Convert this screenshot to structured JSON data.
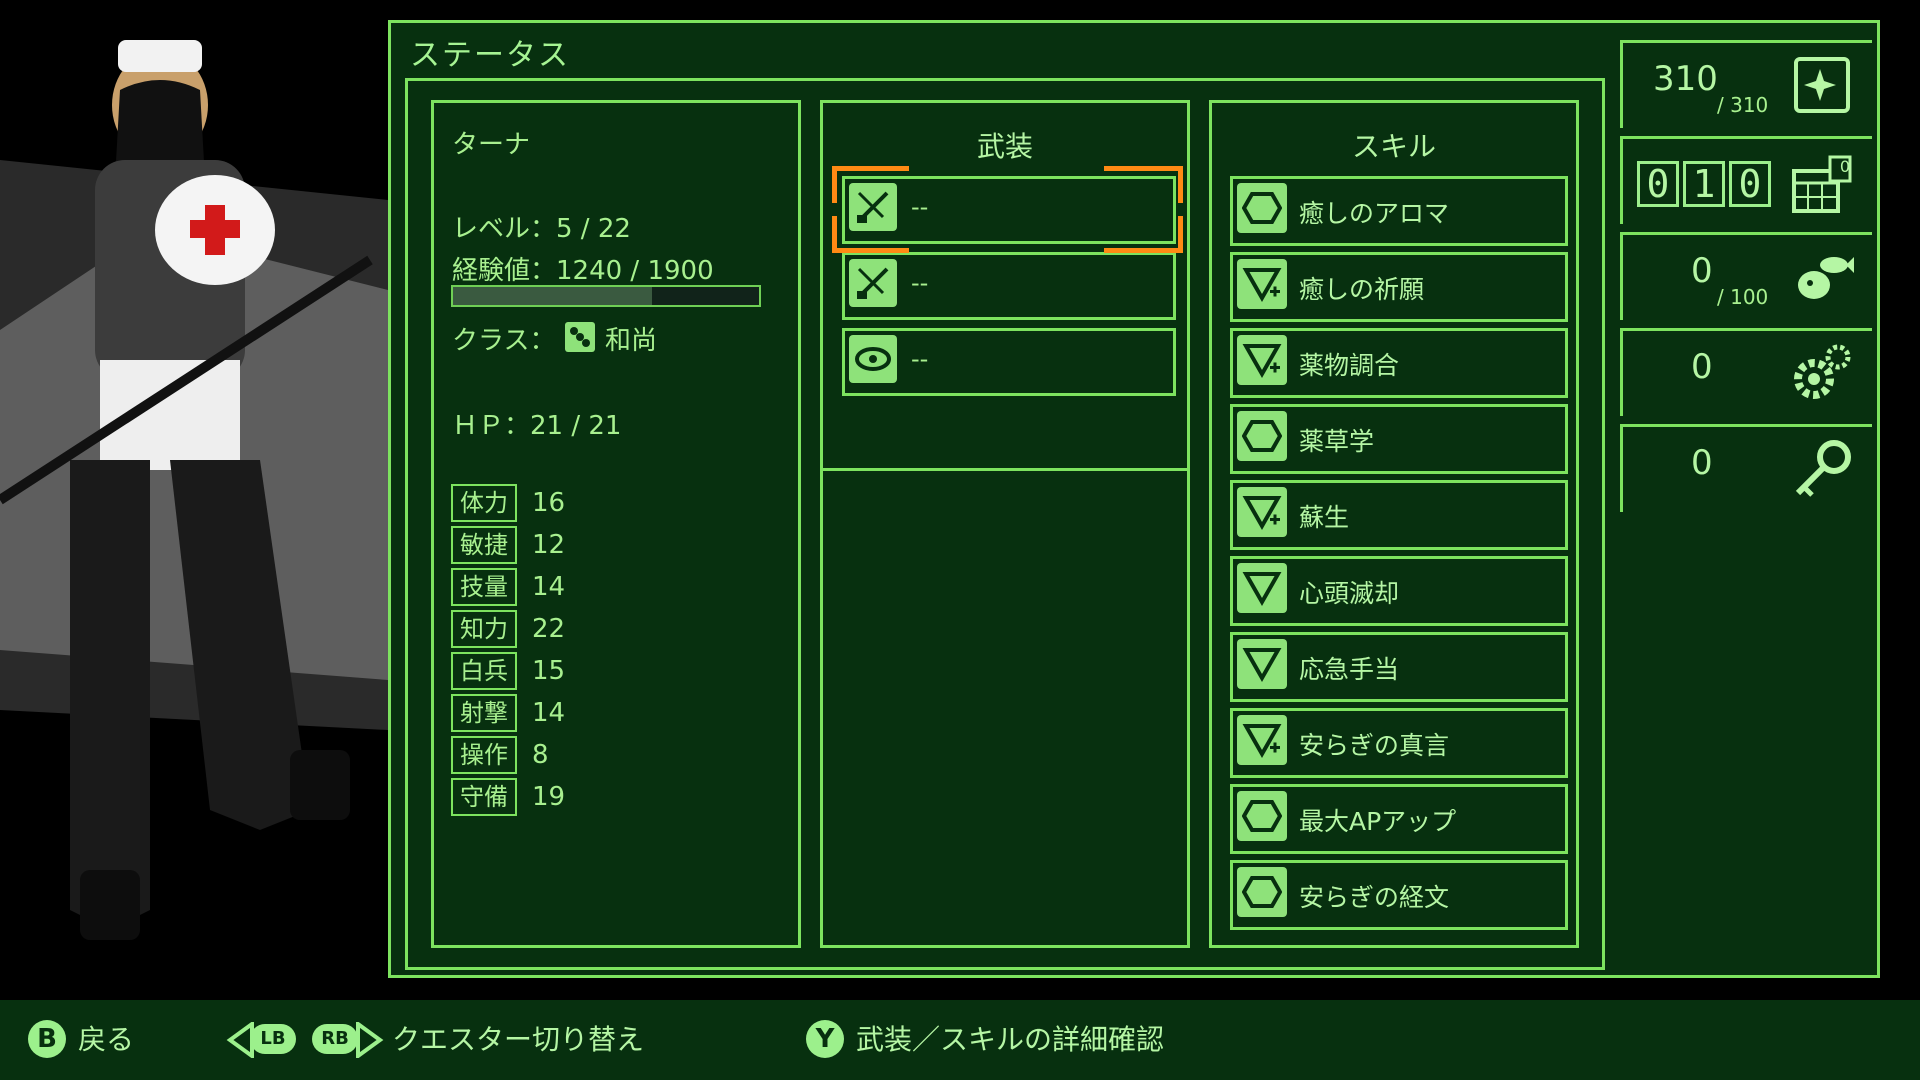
{
  "screen_title": "ステータス",
  "character": {
    "name": "ターナ",
    "level_text": "レベル：5 / 22",
    "exp_text": "経験値：1240 / 1900",
    "exp_progress": 0.65,
    "class_prefix": "クラス：",
    "class_name": "和尚",
    "hp_text": "ＨＰ：21 / 21",
    "stats": [
      {
        "label": "体力",
        "value": "16"
      },
      {
        "label": "敏捷",
        "value": "12"
      },
      {
        "label": "技量",
        "value": "14"
      },
      {
        "label": "知力",
        "value": "22"
      },
      {
        "label": "白兵",
        "value": "15"
      },
      {
        "label": "射撃",
        "value": "14"
      },
      {
        "label": "操作",
        "value": "8"
      },
      {
        "label": "守備",
        "value": "19"
      }
    ]
  },
  "equipment": {
    "header": "武装",
    "slots": [
      {
        "icon": "melee-weapon-icon",
        "label": "--"
      },
      {
        "icon": "melee-weapon-icon",
        "label": "--"
      },
      {
        "icon": "accessory-icon",
        "label": "--"
      }
    ]
  },
  "skills": {
    "header": "スキル",
    "items": [
      {
        "icon": "passive-skill-icon",
        "label": "癒しのアロマ"
      },
      {
        "icon": "active-plus-skill-icon",
        "label": "癒しの祈願"
      },
      {
        "icon": "active-plus-skill-icon",
        "label": "薬物調合"
      },
      {
        "icon": "passive-skill-icon",
        "label": "薬草学"
      },
      {
        "icon": "active-plus-skill-icon",
        "label": "蘇生"
      },
      {
        "icon": "active-skill-icon",
        "label": "心頭滅却"
      },
      {
        "icon": "active-skill-icon",
        "label": "応急手当"
      },
      {
        "icon": "active-plus-skill-icon",
        "label": "安らぎの真言"
      },
      {
        "icon": "passive-skill-icon",
        "label": "最大APアップ"
      },
      {
        "icon": "passive-skill-icon",
        "label": "安らぎの経文"
      }
    ]
  },
  "side": {
    "ap_value": "310",
    "ap_max": "/ 310",
    "day_digits": [
      "0",
      "1",
      "0"
    ],
    "calendar_badge": "0",
    "food_value": "0",
    "food_max": "/ 100",
    "parts_value": "0",
    "keys_value": "0"
  },
  "hints": {
    "back_button": "B",
    "back": "戻る",
    "lb": "LB",
    "rb": "RB",
    "switch": "クエスター切り替え",
    "y_button": "Y",
    "detail": "武装／スキルの詳細確認"
  },
  "colors": {
    "frame": "#7de35f",
    "panel_bg": "#07300f",
    "text": "#a8f08f",
    "selection": "#ff8a14"
  }
}
